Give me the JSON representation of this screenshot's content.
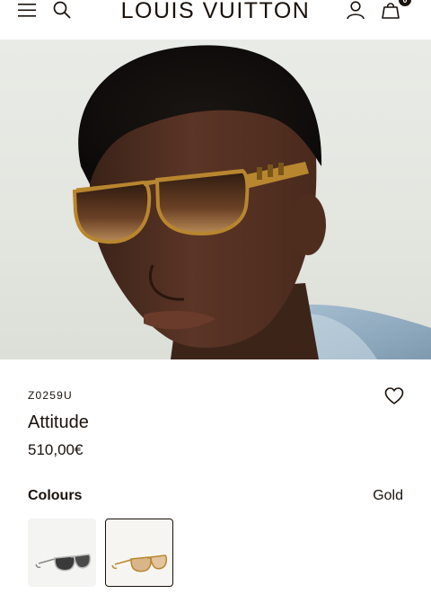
{
  "header": {
    "brand": "LOUIS VUITTON",
    "bag_count": "0",
    "icons": {
      "menu": "menu-icon",
      "search": "search-icon",
      "account": "account-icon",
      "bag": "shopping-bag-icon"
    }
  },
  "hero": {
    "image": "model-wearing-gold-sunglasses"
  },
  "product": {
    "sku": "Z0259U",
    "name": "Attitude",
    "price": "510,00€",
    "wishlist_icon": "heart-icon"
  },
  "colours": {
    "label": "Colours",
    "selected": "Gold",
    "swatches": [
      {
        "name": "silver-variant",
        "selected": false
      },
      {
        "name": "gold-variant",
        "selected": true
      }
    ]
  },
  "colors": {
    "text": "#19110b",
    "background": "#ffffff",
    "frame_gold": "#b8862f",
    "lens_brown": "#5a3a26"
  }
}
